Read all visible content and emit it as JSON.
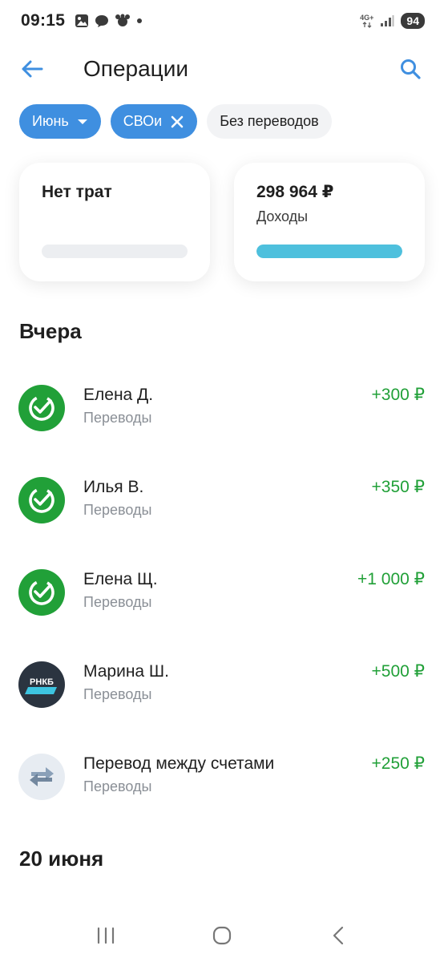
{
  "status_bar": {
    "time": "09:15",
    "network": "4G+",
    "battery": "94"
  },
  "header": {
    "title": "Операции",
    "back_icon": "arrow-left-icon",
    "search_icon": "search-icon"
  },
  "filters": [
    {
      "label": "Июнь",
      "active": true,
      "icon": "caret-down-icon"
    },
    {
      "label": "СВОи",
      "active": true,
      "icon": "close-icon"
    },
    {
      "label": "Без переводов",
      "active": false
    }
  ],
  "summary": {
    "expenses": {
      "title": "Нет трат",
      "bar_fill": 0
    },
    "income": {
      "title": "298 964 ₽",
      "subtitle": "Доходы",
      "bar_fill": 1.0
    }
  },
  "sections": [
    {
      "heading": "Вчера",
      "transactions": [
        {
          "name": "Елена Д.",
          "category": "Переводы",
          "amount": "+300 ₽",
          "avatar": "sber-icon"
        },
        {
          "name": "Илья В.",
          "category": "Переводы",
          "amount": "+350 ₽",
          "avatar": "sber-icon"
        },
        {
          "name": "Елена Щ.",
          "category": "Переводы",
          "amount": "+1 000 ₽",
          "avatar": "sber-icon"
        },
        {
          "name": "Марина Ш.",
          "category": "Переводы",
          "amount": "+500 ₽",
          "avatar": "rnkb-icon",
          "avatar_text": "РНКБ"
        },
        {
          "name": "Перевод между счетами",
          "category": "Переводы",
          "amount": "+250 ₽",
          "avatar": "transfer-icon"
        }
      ]
    },
    {
      "heading": "20 июня",
      "transactions": []
    }
  ],
  "colors": {
    "accent": "#3f8fe0",
    "income_green": "#21a038",
    "bar_cyan": "#4ec0dd",
    "muted_text": "#8a8f96"
  },
  "nav": {
    "recents_icon": "recents-icon",
    "home_icon": "home-icon",
    "back_icon": "back-icon"
  }
}
